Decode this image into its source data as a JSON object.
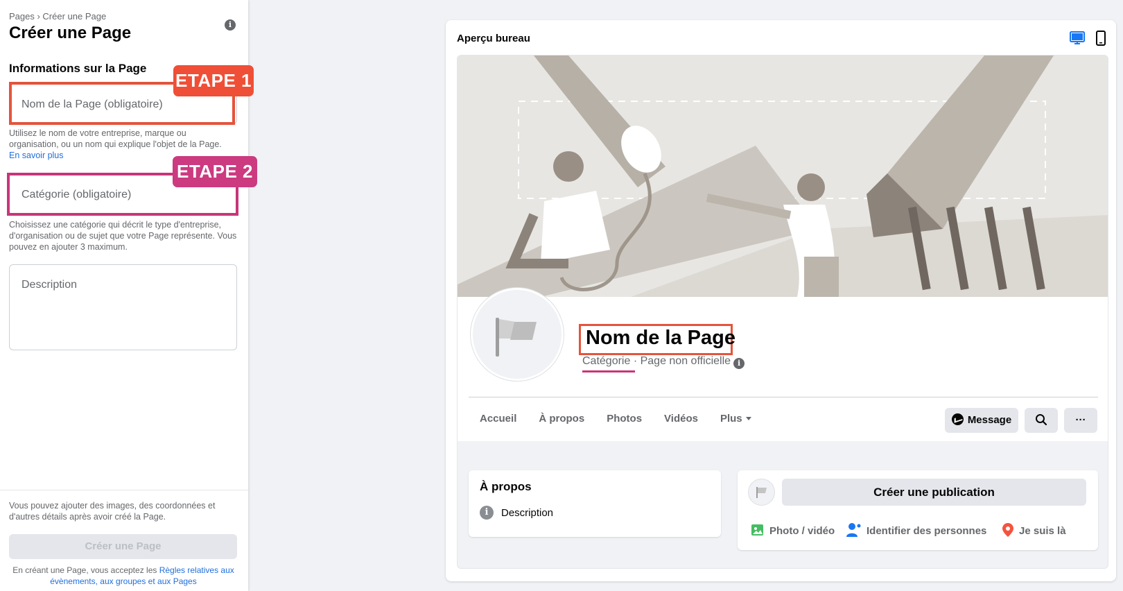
{
  "left_panel": {
    "breadcrumb": "Pages › Créer une Page",
    "title": "Créer une Page",
    "section_title": "Informations sur la Page",
    "name_field": {
      "placeholder": "Nom de la Page (obligatoire)"
    },
    "name_help": "Utilisez le nom de votre entreprise, marque ou organisation, ou un nom qui explique l'objet de la Page.",
    "name_help_link": "En savoir plus",
    "category_field": {
      "placeholder": "Catégorie (obligatoire)"
    },
    "category_help": "Choisissez une catégorie qui décrit le type d'entreprise, d'organisation ou de sujet que votre Page représente. Vous pouvez en ajouter 3 maximum.",
    "description_field": {
      "placeholder": "Description"
    },
    "bottom_text": "Vous pouvez ajouter des images, des coordonnées et d'autres détails après avoir créé la Page.",
    "create_button": "Créer une Page",
    "legal_prefix": "En créant une Page, vous acceptez les ",
    "legal_link": "Règles relatives aux évènements, aux groupes et aux Pages"
  },
  "annotations": {
    "step1": "ETAPE 1",
    "step2": "ETAPE 2",
    "step1_color": "#ef4f37",
    "step2_color": "#cc3a80"
  },
  "preview": {
    "title": "Aperçu bureau",
    "page_name": "Nom de la Page",
    "category": "Catégorie",
    "separator": " · ",
    "page_status": "Page non officielle",
    "tabs": [
      "Accueil",
      "À propos",
      "Photos",
      "Vidéos",
      "Plus"
    ],
    "message_button": "Message",
    "more_button": "···",
    "about_title": "À propos",
    "about_description": "Description",
    "create_post": "Créer une publication",
    "actions": [
      "Photo / vidéo",
      "Identifier des personnes",
      "Je suis là"
    ],
    "icons": [
      "desktop-icon",
      "mobile-icon",
      "flag-icon",
      "messenger-icon",
      "search-icon",
      "info-icon",
      "photo-icon",
      "tag-people-icon",
      "location-pin-icon"
    ]
  },
  "colors": {
    "accent_blue": "#1877f2",
    "link_blue": "#216fdb",
    "photo_green": "#45bd62",
    "location_red": "#f5533d"
  }
}
